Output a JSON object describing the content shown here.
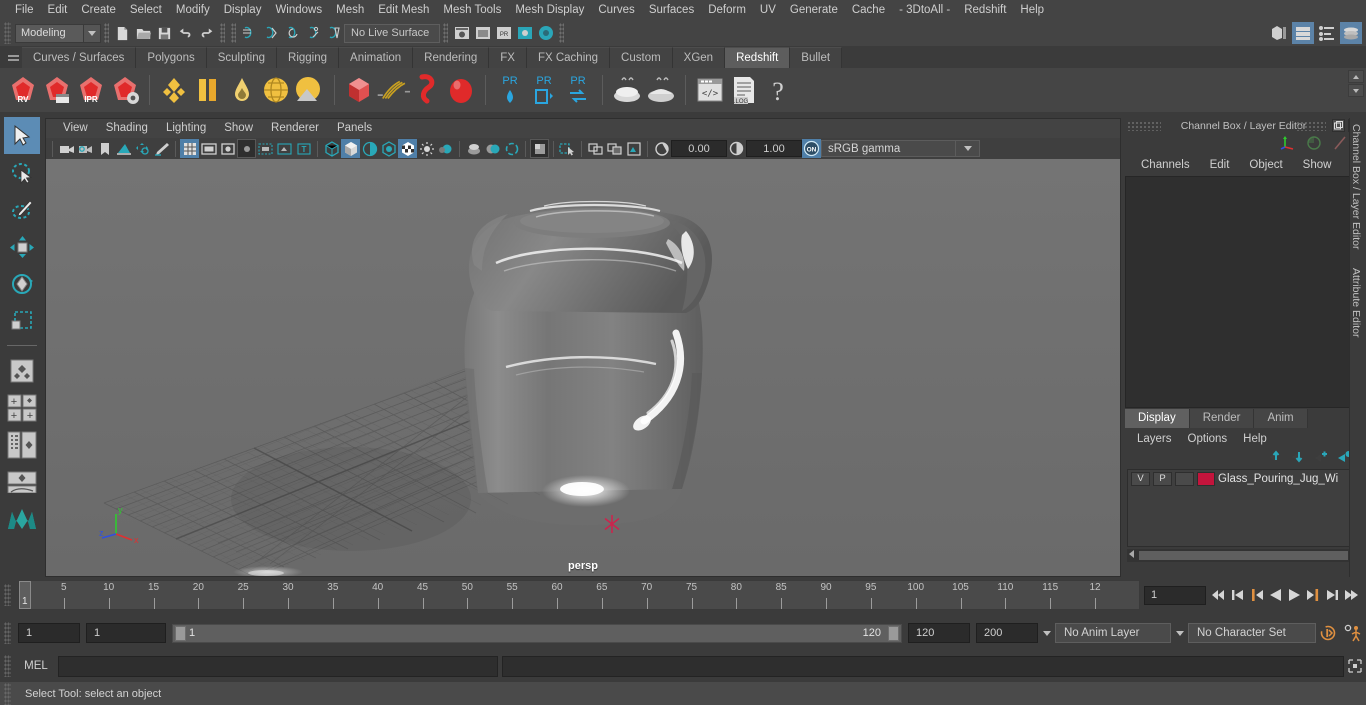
{
  "menubar": {
    "items": [
      "File",
      "Edit",
      "Create",
      "Select",
      "Modify",
      "Display",
      "Windows",
      "Mesh",
      "Edit Mesh",
      "Mesh Tools",
      "Mesh Display",
      "Curves",
      "Surfaces",
      "Deform",
      "UV",
      "Generate",
      "Cache",
      "- 3DtoAll -",
      "Redshift",
      "Help"
    ]
  },
  "statusline": {
    "menuset": "Modeling",
    "live_surface": "No Live Surface",
    "icons": [
      "new-scene-icon",
      "open-scene-icon",
      "save-scene-icon",
      "undo-icon",
      "redo-icon",
      "select-by-hierarchy-icon",
      "select-by-object-icon",
      "select-by-component-icon",
      "snap-grid-icon",
      "snap-curve-icon",
      "snap-point-icon",
      "snap-projected-icon",
      "snap-view-icon",
      "render-current-frame-icon",
      "ipr-render-icon",
      "render-settings-icon",
      "hypershade-icon",
      "outliner-icon",
      "node-editor-icon",
      "attribute-editor-icon",
      "channel-box-icon"
    ]
  },
  "shelf": {
    "tabs": [
      "Curves / Surfaces",
      "Polygons",
      "Sculpting",
      "Rigging",
      "Animation",
      "Rendering",
      "FX",
      "FX Caching",
      "Custom",
      "XGen",
      "Redshift",
      "Bullet"
    ],
    "active_tab": "Redshift",
    "buttons": [
      {
        "name": "redshift-render-view",
        "label": "RV"
      },
      {
        "name": "redshift-render-sequence",
        "label": ""
      },
      {
        "name": "redshift-ipr",
        "label": "IPR"
      },
      {
        "name": "redshift-render-settings",
        "label": ""
      },
      {
        "name": "redshift-material",
        "label": ""
      },
      {
        "name": "redshift-material-blender",
        "label": ""
      },
      {
        "name": "redshift-incandescent",
        "label": ""
      },
      {
        "name": "redshift-sub-surface",
        "label": ""
      },
      {
        "name": "redshift-environment",
        "label": ""
      },
      {
        "name": "redshift-proxy",
        "label": ""
      },
      {
        "name": "redshift-hair",
        "label": ""
      },
      {
        "name": "redshift-volume",
        "label": ""
      },
      {
        "name": "redshift-sprite",
        "label": ""
      },
      {
        "name": "redshift-pr-light",
        "label": "PR"
      },
      {
        "name": "redshift-pr-portal",
        "label": "PR"
      },
      {
        "name": "redshift-pr-settings",
        "label": "PR"
      },
      {
        "name": "redshift-bake-set",
        "label": ""
      },
      {
        "name": "redshift-bake-all",
        "label": ""
      },
      {
        "name": "redshift-script",
        "label": ""
      },
      {
        "name": "redshift-log",
        "label": ".LOG"
      },
      {
        "name": "redshift-help",
        "label": "?"
      }
    ]
  },
  "toolbox": {
    "items": [
      {
        "name": "select-tool",
        "selected": true
      },
      {
        "name": "lasso-select-tool",
        "selected": false
      },
      {
        "name": "paint-select-tool",
        "selected": false
      },
      {
        "name": "move-tool",
        "selected": false
      },
      {
        "name": "rotate-tool",
        "selected": false
      },
      {
        "name": "scale-tool",
        "selected": false
      },
      {
        "name": "last-tool-used",
        "selected": false
      },
      {
        "name": "single-perspective-layout",
        "selected": false
      },
      {
        "name": "four-view-layout",
        "selected": false
      },
      {
        "name": "persp-outliner-layout",
        "selected": false
      },
      {
        "name": "persp-graph-layout",
        "selected": false
      },
      {
        "name": "maya-logo",
        "selected": false
      }
    ]
  },
  "viewport": {
    "menus": [
      "View",
      "Shading",
      "Lighting",
      "Show",
      "Renderer",
      "Panels"
    ],
    "exposure": "0.00",
    "gamma": "1.00",
    "color_management": "sRGB gamma",
    "view_gate_toggle": "ON",
    "camera_label": "persp",
    "axis": {
      "x": "x",
      "y": "y",
      "z": "z"
    },
    "toolbar_icons": [
      "select-camera-icon",
      "camera-attributes-icon",
      "bookmark-icon",
      "image-plane-icon",
      "2d-pan-zoom-icon",
      "grease-pencil-icon",
      "grid-toggle-icon",
      "film-gate-icon",
      "resolution-gate-icon",
      "gate-mask-icon",
      "field-chart-icon",
      "safe-action-icon",
      "safe-title-icon",
      "wireframe-icon",
      "smooth-shade-all-icon",
      "flat-shade-icon",
      "use-default-material-icon",
      "shaded-textured-icon",
      "use-all-lights-icon",
      "shadows-icon",
      "screen-space-ao-icon",
      "motion-blur-icon",
      "multisample-aa-icon",
      "depth-of-field-icon",
      "isolate-select-icon",
      "xray-icon",
      "xray-joints-icon",
      "xray-active-components-icon",
      "exposure-icon",
      "contrast-icon"
    ]
  },
  "channel_box": {
    "title": "Channel Box / Layer Editor",
    "window_buttons": [
      "undock-icon",
      "close-icon"
    ],
    "header_icons": [
      "show-manipulator-icon",
      "channel-graph-icon",
      "speed-icon"
    ],
    "menus": [
      "Channels",
      "Edit",
      "Object",
      "Show"
    ],
    "content": ""
  },
  "layer_editor": {
    "tabs": [
      "Display",
      "Render",
      "Anim"
    ],
    "active_tab": "Display",
    "menus": [
      "Layers",
      "Options",
      "Help"
    ],
    "icons": [
      "move-layer-up-icon",
      "move-layer-down-icon",
      "new-layer-icon",
      "new-layer-from-selected-icon"
    ],
    "layers": [
      {
        "visibility": "V",
        "playback": "P",
        "type": "",
        "color": "#c4143c",
        "name": "Glass_Pouring_Jug_Wi"
      }
    ]
  },
  "right_dock": {
    "tab_labels": [
      "Channel Box / Layer Editor",
      "Attribute Editor"
    ]
  },
  "timeslider": {
    "ticks": [
      "5",
      "10",
      "15",
      "20",
      "25",
      "30",
      "35",
      "40",
      "45",
      "50",
      "55",
      "60",
      "65",
      "70",
      "75",
      "80",
      "85",
      "90",
      "95",
      "100",
      "105",
      "110",
      "115",
      "12"
    ],
    "current_frame_marker": "1",
    "current_frame_field": "1",
    "transport_buttons": [
      "go-to-start-icon",
      "step-back-keyframe-icon",
      "step-back-frame-icon",
      "play-backwards-icon",
      "play-forwards-icon",
      "step-forward-frame-icon",
      "step-forward-keyframe-icon",
      "go-to-end-icon"
    ]
  },
  "rangebar": {
    "anim_start": "1",
    "range_start": "1",
    "slider_start_label": "1",
    "slider_end_label": "120",
    "range_end": "120",
    "anim_end": "200",
    "anim_layer": "No Anim Layer",
    "character_set": "No Character Set",
    "buttons": [
      "auto-key-icon",
      "animation-preferences-icon"
    ]
  },
  "commandline": {
    "language_label": "MEL",
    "input_value": "",
    "output_value": "",
    "script-editor-button": "script-editor-icon"
  },
  "helpline": {
    "message": "Select Tool: select an object"
  },
  "colors": {
    "accent_blue": "#5c8cb5",
    "redshift_red": "#e03a3a",
    "layer_red": "#c4143c",
    "orange": "#e08a3c",
    "teal": "#29a8b8"
  }
}
